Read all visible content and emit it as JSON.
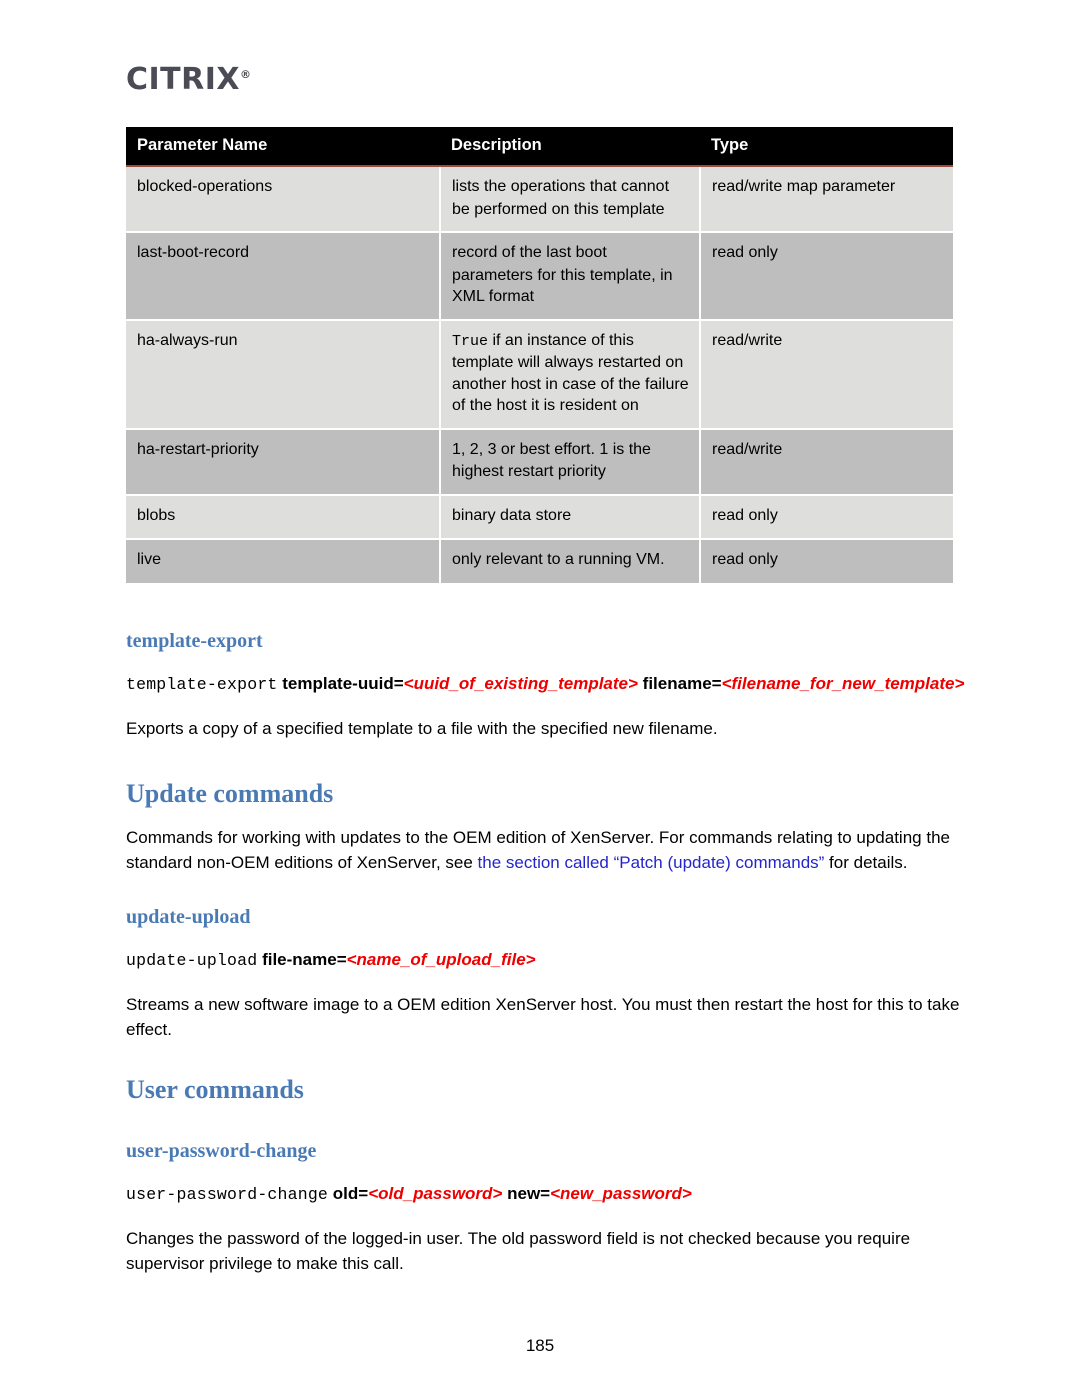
{
  "brand": {
    "logo_text": "CITRIX",
    "registered_mark": "®"
  },
  "table": {
    "headers": {
      "parameter_name": "Parameter Name",
      "description": "Description",
      "type": "Type"
    },
    "rows": [
      {
        "name": "blocked-operations",
        "desc_prefix": "",
        "desc": "lists the operations that cannot be performed on this template",
        "type": "read/write map parameter"
      },
      {
        "name": "last-boot-record",
        "desc_prefix": "",
        "desc": "record of the last boot parameters for this template, in XML format",
        "type": "read only"
      },
      {
        "name": "ha-always-run",
        "desc_prefix": "True",
        "desc": "if an instance of this template will always restarted on another host in case of the failure of the host it is resident on",
        "type": "read/write"
      },
      {
        "name": "ha-restart-priority",
        "desc_prefix": "",
        "desc": "1, 2, 3 or best effort. 1 is the highest restart priority",
        "type": "read/write"
      },
      {
        "name": "blobs",
        "desc_prefix": "",
        "desc": "binary data store",
        "type": "read only"
      },
      {
        "name": "live",
        "desc_prefix": "",
        "desc": "only relevant to a running VM.",
        "type": "read only"
      }
    ]
  },
  "sections": {
    "template_export": {
      "heading": "template-export",
      "cmd_name": "template-export",
      "arg1": "template-uuid=",
      "repl1": "<uuid_of_existing_template>",
      "arg2": "filename=",
      "repl2": "<filename_for_new_template>",
      "body": "Exports a copy of a specified template to a file with the specified new filename."
    },
    "update_commands": {
      "heading": "Update commands",
      "body_part1": "Commands for working with updates to the OEM edition of XenServer. For commands relating to updating the standard non-OEM editions of XenServer, see ",
      "link_text": "the section called “Patch (update) commands”",
      "body_part2": " for details."
    },
    "update_upload": {
      "heading": "update-upload",
      "cmd_name": "update-upload",
      "arg1": "file-name=",
      "repl1": "<name_of_upload_file>",
      "body": "Streams a new software image to a OEM edition XenServer host. You must then restart the host for this to take effect."
    },
    "user_commands": {
      "heading": "User commands"
    },
    "user_password_change": {
      "heading": "user-password-change",
      "cmd_name": "user-password-change",
      "arg1": "old=",
      "repl1": "<old_password>",
      "arg2": "new=",
      "repl2": "<new_password>",
      "body": "Changes the password of the logged-in user. The old password field is not checked because you require supervisor privilege to make this call."
    }
  },
  "footer": {
    "page_number": "185"
  },
  "colors": {
    "heading_blue": "#4a7ab4",
    "link_blue": "#2424cc",
    "replaceable_red": "#ee0000",
    "header_black": "#000000",
    "row_light": "#dededd",
    "row_dark": "#bebebe",
    "header_rule": "#9c4a3c",
    "logo_gray": "#4b4b55"
  }
}
